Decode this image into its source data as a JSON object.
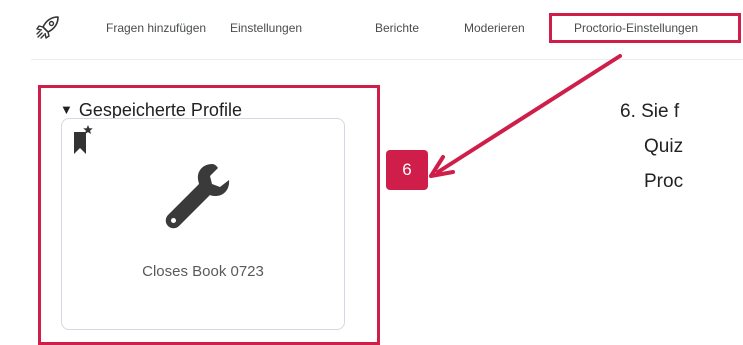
{
  "nav": {
    "items": [
      {
        "label": "Fragen hinzufügen"
      },
      {
        "label": "Einstellungen"
      },
      {
        "label": "Berichte"
      },
      {
        "label": "Moderieren"
      },
      {
        "label": "Proctorio-Einstellungen"
      }
    ],
    "logo_icon": "rocket-icon"
  },
  "saved_profiles": {
    "heading": "Gespeicherte Profile",
    "toggle_icon": "triangle-down-icon",
    "profile": {
      "name": "Closes Book 0723",
      "icon": "wrench-icon",
      "badge_icon": "bookmark-star-icon"
    }
  },
  "annotation": {
    "step_number": "6",
    "instruction_lines": [
      "6. Sie f",
      "Quiz",
      "Proc"
    ],
    "accent_color": "#cf1e4a"
  }
}
